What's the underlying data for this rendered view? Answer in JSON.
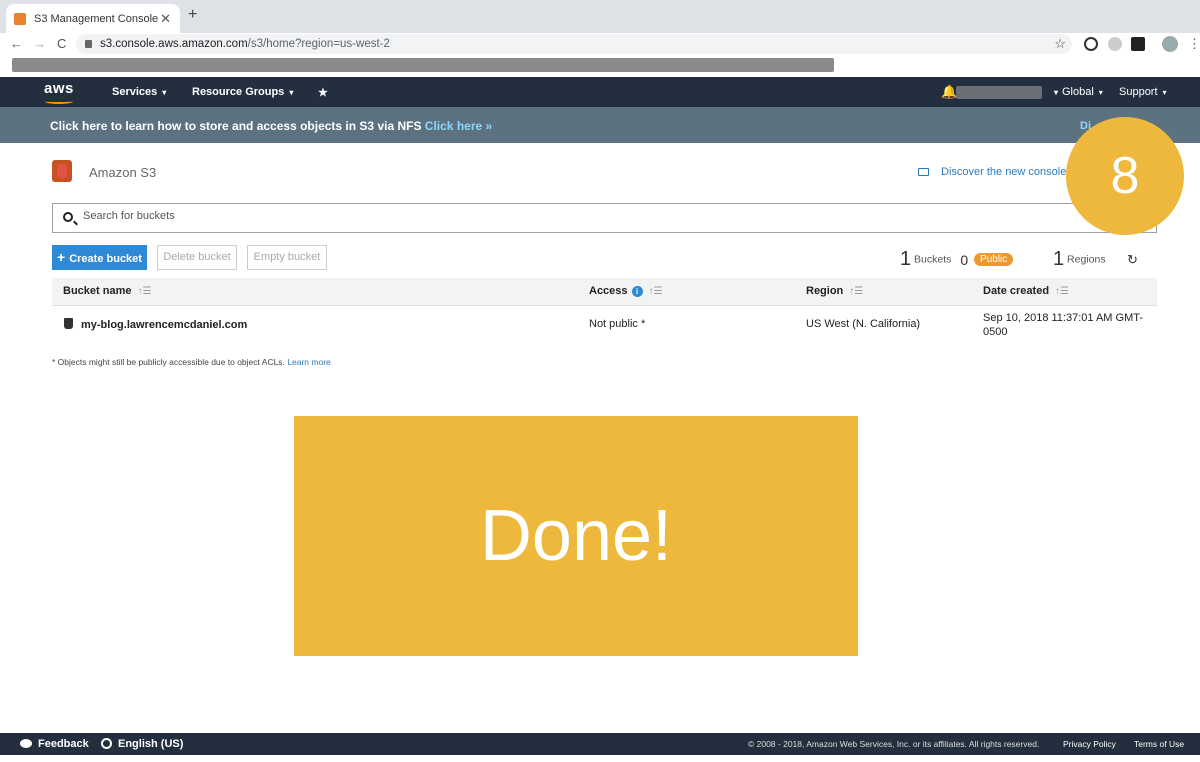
{
  "browser": {
    "tab_title": "S3 Management Console",
    "tab_close": "✕",
    "new_tab": "+",
    "back": "←",
    "forward": "→",
    "reload": "C",
    "url_domain": "s3.console.aws.amazon.com",
    "url_path": "/s3/home?region=us-west-2",
    "star": "☆"
  },
  "aws_nav": {
    "logo": "aws",
    "services": "Services",
    "resource_groups": "Resource Groups",
    "pin": "★",
    "bell": "♫",
    "global": "Global",
    "support": "Support",
    "caret": "▾"
  },
  "banner": {
    "message": "Click here to learn how to store and access objects in S3 via NFS ",
    "link": "Click here »",
    "dismiss": "Di"
  },
  "header": {
    "title": "Amazon S3",
    "discover": "Discover the new console"
  },
  "search": {
    "placeholder": "Search for buckets"
  },
  "toolbar": {
    "create": "Create bucket",
    "create_plus": "+",
    "delete": "Delete bucket",
    "empty": "Empty bucket"
  },
  "counts": {
    "buckets_num": "1",
    "buckets_label": "Buckets",
    "public_num": "0",
    "public_label": "Public",
    "regions_num": "1",
    "regions_label": "Regions",
    "refresh": "↻"
  },
  "table": {
    "headers": {
      "name": "Bucket name",
      "access": "Access",
      "region": "Region",
      "date": "Date created",
      "sort": "↑☰"
    },
    "rows": [
      {
        "name": "my-blog.lawrencemcdaniel.com",
        "access": "Not public *",
        "region": "US West (N. California)",
        "date_line1": "Sep 10, 2018 11:37:01 AM GMT-",
        "date_line2": "0500"
      }
    ]
  },
  "footnote": {
    "text": "* Objects might still be publicly accessible due to object ACLs. ",
    "link": "Learn more"
  },
  "overlay": {
    "done": "Done!",
    "step": "8"
  },
  "footer": {
    "feedback": "Feedback",
    "language": "English (US)",
    "copyright": "© 2008 - 2018, Amazon Web Services, Inc. or its affiliates. All rights reserved.",
    "privacy": "Privacy Policy",
    "terms": "Terms of Use"
  },
  "colors": {
    "aws_nav": "#232f3e",
    "banner": "#5d7281",
    "primary": "#2e8ad6",
    "overlay": "#eeb83d",
    "public_badge": "#eb9a2d"
  }
}
